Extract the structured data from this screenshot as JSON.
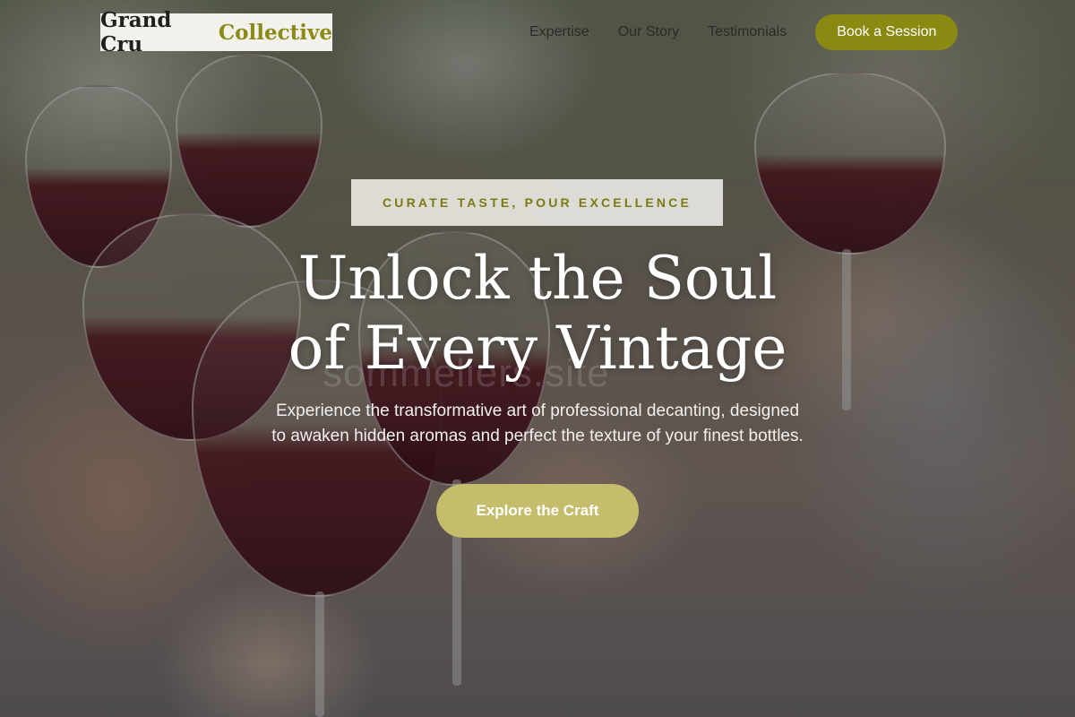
{
  "header": {
    "logo_main": "Grand Cru",
    "logo_accent": "Collective",
    "nav": [
      {
        "label": "Expertise"
      },
      {
        "label": "Our Story"
      },
      {
        "label": "Testimonials"
      }
    ],
    "cta_label": "Book a Session"
  },
  "hero": {
    "eyebrow": "CURATE TASTE, POUR EXCELLENCE",
    "title_line1": "Unlock the Soul",
    "title_line2": "of Every Vintage",
    "subtitle_line1": "Experience the transformative art of professional decanting, designed",
    "subtitle_line2": "to awaken hidden aromas and perfect the texture of your finest bottles.",
    "cta_label": "Explore the Craft",
    "watermark": "sommeliers.site"
  },
  "colors": {
    "accent_olive": "#8a8a12",
    "cta_gold": "#c4bd6c",
    "wine": "#5a0a19"
  },
  "background_image": "people-toasting-red-wine-glasses"
}
